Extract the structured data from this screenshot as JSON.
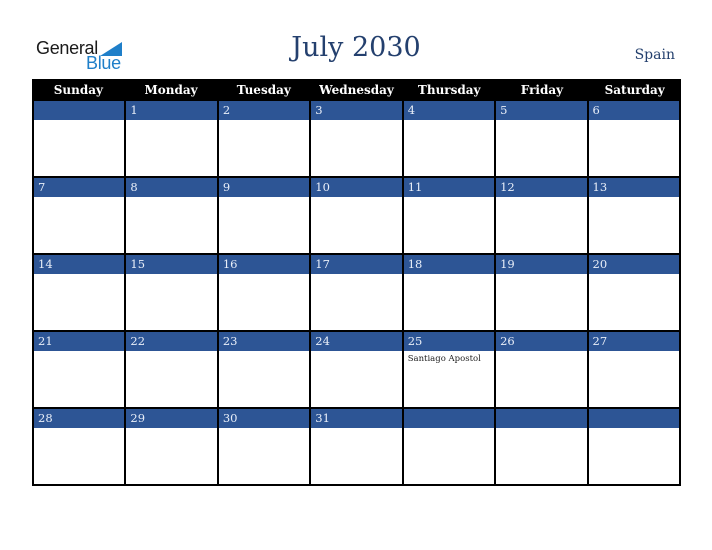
{
  "logo": {
    "line1": "General",
    "line2": "Blue",
    "icon": "triangle-flag-icon"
  },
  "title": "July 2030",
  "country": "Spain",
  "colors": {
    "header_bg": "#000000",
    "date_bar": "#2d5595",
    "title": "#24406e",
    "logo_blue": "#1f7fc9"
  },
  "weekdays": [
    "Sunday",
    "Monday",
    "Tuesday",
    "Wednesday",
    "Thursday",
    "Friday",
    "Saturday"
  ],
  "weeks": [
    [
      {
        "day": ""
      },
      {
        "day": "1"
      },
      {
        "day": "2"
      },
      {
        "day": "3"
      },
      {
        "day": "4"
      },
      {
        "day": "5"
      },
      {
        "day": "6"
      }
    ],
    [
      {
        "day": "7"
      },
      {
        "day": "8"
      },
      {
        "day": "9"
      },
      {
        "day": "10"
      },
      {
        "day": "11"
      },
      {
        "day": "12"
      },
      {
        "day": "13"
      }
    ],
    [
      {
        "day": "14"
      },
      {
        "day": "15"
      },
      {
        "day": "16"
      },
      {
        "day": "17"
      },
      {
        "day": "18"
      },
      {
        "day": "19"
      },
      {
        "day": "20"
      }
    ],
    [
      {
        "day": "21"
      },
      {
        "day": "22"
      },
      {
        "day": "23"
      },
      {
        "day": "24"
      },
      {
        "day": "25",
        "event": "Santiago Apostol"
      },
      {
        "day": "26"
      },
      {
        "day": "27"
      }
    ],
    [
      {
        "day": "28"
      },
      {
        "day": "29"
      },
      {
        "day": "30"
      },
      {
        "day": "31"
      },
      {
        "day": ""
      },
      {
        "day": ""
      },
      {
        "day": ""
      }
    ]
  ]
}
